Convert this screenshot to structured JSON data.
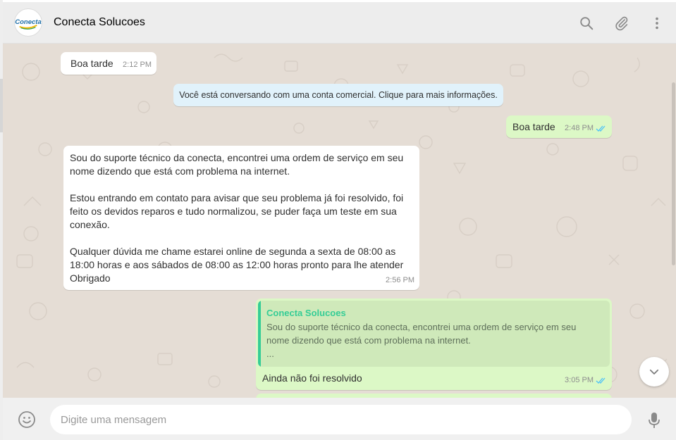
{
  "header": {
    "contact_name": "Conecta Solucoes",
    "avatar_text": "Conecta"
  },
  "icons": [
    "search-icon",
    "attach-icon",
    "menu-icon",
    "double-check-icon",
    "chevron-down-icon",
    "emoji-icon",
    "mic-icon"
  ],
  "colors": {
    "chat_bg": "#e5ddd5",
    "outgoing_bubble": "#dcf8c6",
    "incoming_bubble": "#ffffff",
    "system_bubble": "#e1f2fb",
    "quote_accent": "#35cd96",
    "read_tick": "#4fc3f7"
  },
  "messages": {
    "m1": {
      "text": "Boa tarde",
      "time": "2:12 PM"
    },
    "system": {
      "text": "Você está conversando com uma conta comercial. Clique para mais informações."
    },
    "m2": {
      "text": "Boa tarde",
      "time": "2:48 PM"
    },
    "m3": {
      "p1": "Sou do suporte técnico da conecta, encontrei uma  ordem de serviço em seu nome dizendo que está com problema na internet.",
      "p2": "Estou entrando em contato para avisar que seu problema já foi resolvido, foi feito os devidos reparos e tudo normalizou, se puder faça um teste em sua conexão.",
      "p3": "Qualquer dúvida me chame estarei online de segunda a sexta de 08:00 as 18:00 horas e aos sábados de 08:00 as 12:00 horas pronto para lhe atender",
      "p4": "Obrigado",
      "time": "2:56 PM"
    },
    "m4": {
      "quote_author": "Conecta Solucoes",
      "quote_text": "Sou do suporte técnico da conecta, encontrei uma  ordem de serviço em seu nome dizendo que está com problema na internet.\n...",
      "text": "Ainda não foi resolvido",
      "time": "3:05 PM"
    }
  },
  "composer": {
    "placeholder": "Digite uma mensagem"
  }
}
